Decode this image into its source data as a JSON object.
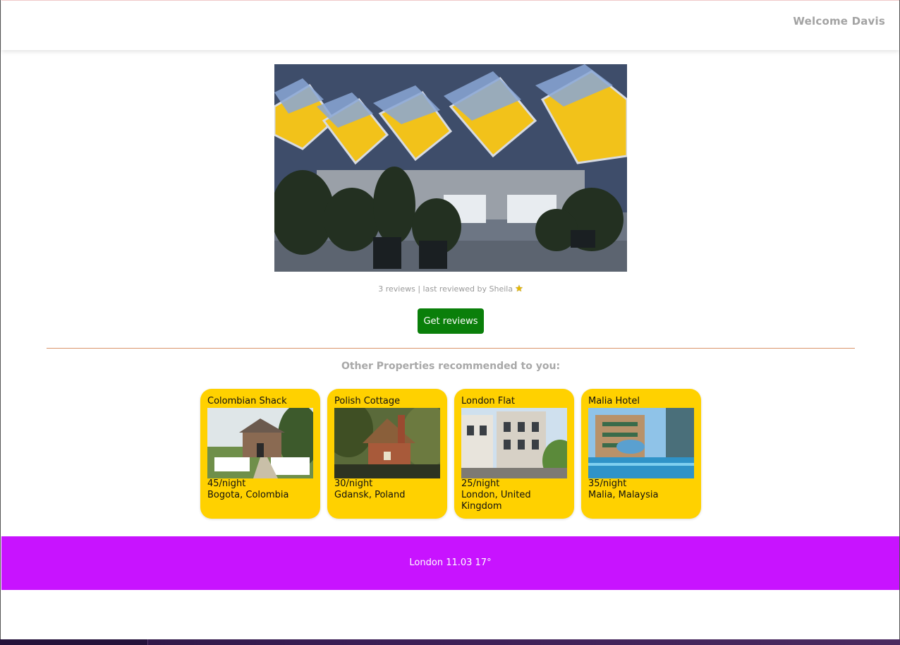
{
  "header": {
    "welcome": "Welcome Davis"
  },
  "property": {
    "reviews_summary": "3 reviews | last reviewed by Sheila",
    "rating_icon": "star-icon",
    "get_reviews_label": "Get reviews"
  },
  "recommendations": {
    "heading": "Other Properties recommended to you:",
    "cards": [
      {
        "name": "Colombian Shack",
        "price": "45/night",
        "location": "Bogota, Colombia"
      },
      {
        "name": "Polish Cottage",
        "price": "30/night",
        "location": "Gdansk, Poland"
      },
      {
        "name": "London Flat",
        "price": "25/night",
        "location": "London, United Kingdom"
      },
      {
        "name": "Malia Hotel",
        "price": "35/night",
        "location": "Malia, Malaysia"
      }
    ]
  },
  "footer": {
    "weather": "London 11.03 17°"
  },
  "colors": {
    "card_bg": "#ffd100",
    "footer_bg": "#c813ff",
    "button_bg": "#0a7f0a",
    "divider": "#d9956a"
  }
}
